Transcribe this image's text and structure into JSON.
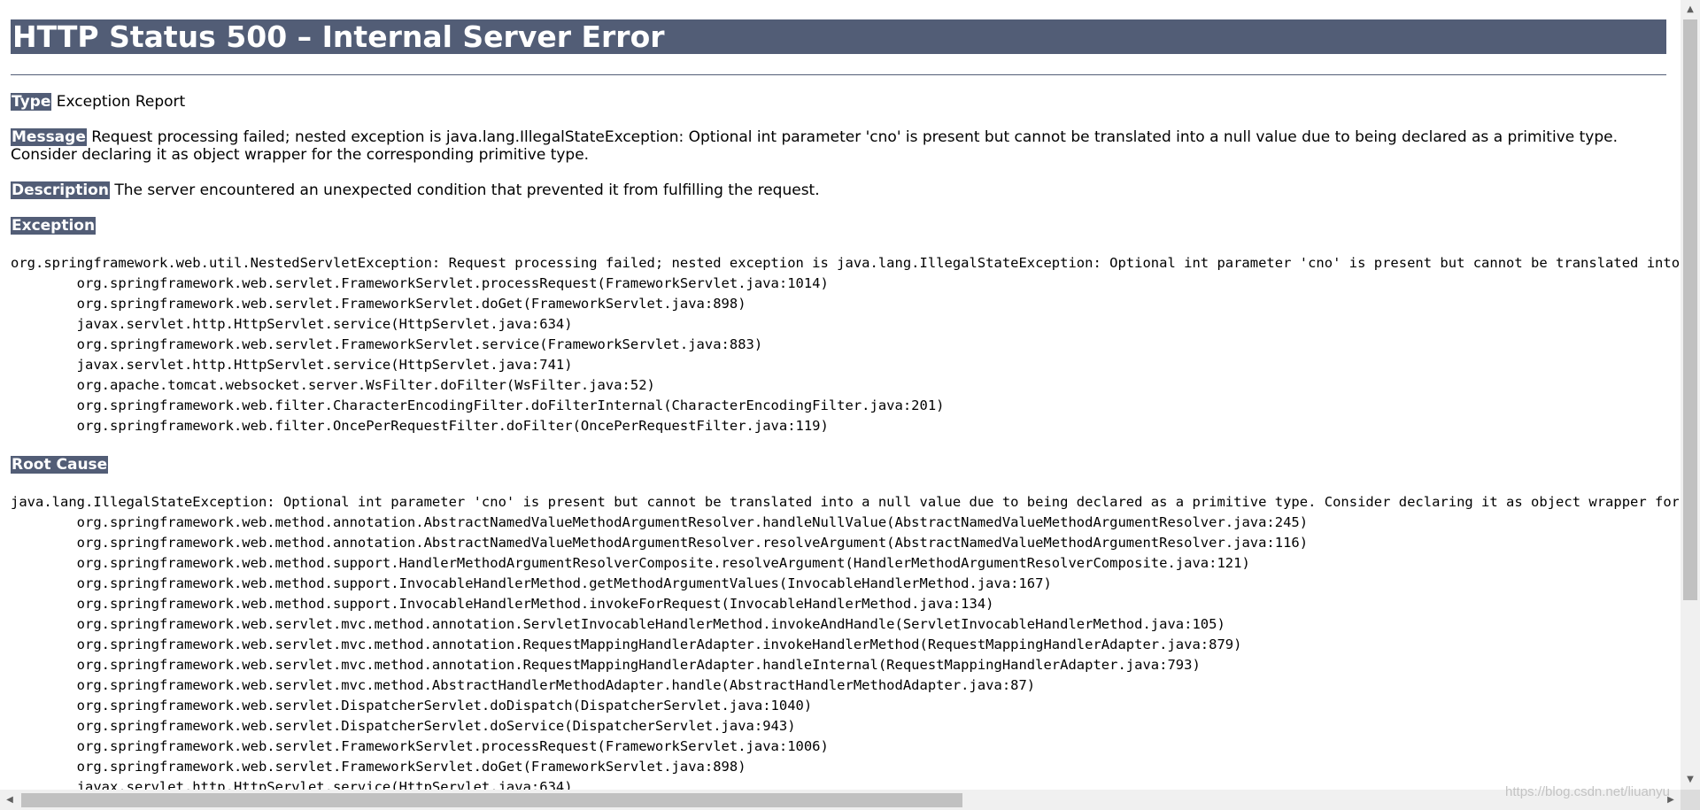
{
  "heading": "HTTP Status 500 – Internal Server Error",
  "type": {
    "label": "Type",
    "value": "Exception Report"
  },
  "message": {
    "label": "Message",
    "value": "Request processing failed; nested exception is java.lang.IllegalStateException: Optional int parameter 'cno' is present but cannot be translated into a null value due to being declared as a primitive type. Consider declaring it as object wrapper for the corresponding primitive type."
  },
  "description": {
    "label": "Description",
    "value": "The server encountered an unexpected condition that prevented it from fulfilling the request."
  },
  "exception": {
    "label": "Exception",
    "trace": "org.springframework.web.util.NestedServletException: Request processing failed; nested exception is java.lang.IllegalStateException: Optional int parameter 'cno' is present but cannot be translated into a null value due to being declared as a primitive type. Consider declaring it as object wrapper for the corresponding primitive type.\n\torg.springframework.web.servlet.FrameworkServlet.processRequest(FrameworkServlet.java:1014)\n\torg.springframework.web.servlet.FrameworkServlet.doGet(FrameworkServlet.java:898)\n\tjavax.servlet.http.HttpServlet.service(HttpServlet.java:634)\n\torg.springframework.web.servlet.FrameworkServlet.service(FrameworkServlet.java:883)\n\tjavax.servlet.http.HttpServlet.service(HttpServlet.java:741)\n\torg.apache.tomcat.websocket.server.WsFilter.doFilter(WsFilter.java:52)\n\torg.springframework.web.filter.CharacterEncodingFilter.doFilterInternal(CharacterEncodingFilter.java:201)\n\torg.springframework.web.filter.OncePerRequestFilter.doFilter(OncePerRequestFilter.java:119)"
  },
  "root_cause": {
    "label": "Root Cause",
    "trace": "java.lang.IllegalStateException: Optional int parameter 'cno' is present but cannot be translated into a null value due to being declared as a primitive type. Consider declaring it as object wrapper for the corresponding primitive type.\n\torg.springframework.web.method.annotation.AbstractNamedValueMethodArgumentResolver.handleNullValue(AbstractNamedValueMethodArgumentResolver.java:245)\n\torg.springframework.web.method.annotation.AbstractNamedValueMethodArgumentResolver.resolveArgument(AbstractNamedValueMethodArgumentResolver.java:116)\n\torg.springframework.web.method.support.HandlerMethodArgumentResolverComposite.resolveArgument(HandlerMethodArgumentResolverComposite.java:121)\n\torg.springframework.web.method.support.InvocableHandlerMethod.getMethodArgumentValues(InvocableHandlerMethod.java:167)\n\torg.springframework.web.method.support.InvocableHandlerMethod.invokeForRequest(InvocableHandlerMethod.java:134)\n\torg.springframework.web.servlet.mvc.method.annotation.ServletInvocableHandlerMethod.invokeAndHandle(ServletInvocableHandlerMethod.java:105)\n\torg.springframework.web.servlet.mvc.method.annotation.RequestMappingHandlerAdapter.invokeHandlerMethod(RequestMappingHandlerAdapter.java:879)\n\torg.springframework.web.servlet.mvc.method.annotation.RequestMappingHandlerAdapter.handleInternal(RequestMappingHandlerAdapter.java:793)\n\torg.springframework.web.servlet.mvc.method.AbstractHandlerMethodAdapter.handle(AbstractHandlerMethodAdapter.java:87)\n\torg.springframework.web.servlet.DispatcherServlet.doDispatch(DispatcherServlet.java:1040)\n\torg.springframework.web.servlet.DispatcherServlet.doService(DispatcherServlet.java:943)\n\torg.springframework.web.servlet.FrameworkServlet.processRequest(FrameworkServlet.java:1006)\n\torg.springframework.web.servlet.FrameworkServlet.doGet(FrameworkServlet.java:898)\n\tjavax.servlet.http.HttpServlet.service(HttpServlet.java:634)"
  },
  "scrollbars": {
    "up_icon": "▲",
    "down_icon": "▼",
    "left_icon": "◀",
    "right_icon": "▶",
    "vertical_position": 0.0,
    "horizontal_position": 0.0
  },
  "watermark": "https://blog.csdn.net/liuanyu"
}
